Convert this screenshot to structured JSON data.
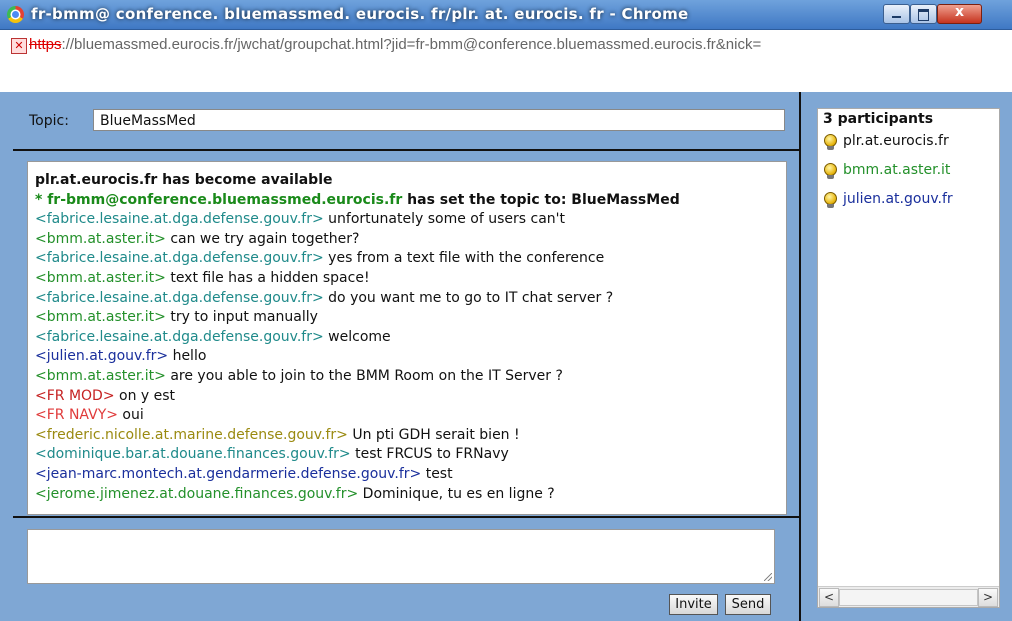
{
  "window": {
    "title": "fr-bmm@ conference. bluemassmed. eurocis. fr/plr. at. eurocis. fr -  Chrome",
    "close_label": "x"
  },
  "address": {
    "scheme": "https",
    "rest": "://bluemassmed.eurocis.fr/jwchat/groupchat.html?jid=fr-bmm@conference.bluemassmed.eurocis.fr&nick="
  },
  "topic": {
    "label": "Topic:",
    "value": "BlueMassMed"
  },
  "chat": {
    "messages": [
      {
        "nick": "",
        "text": "plr.at.eurocis.fr has become available",
        "style": "bold"
      },
      {
        "nick": "* fr-bmm@conference.bluemassmed.eurocis.fr",
        "text": " has set the topic to: BlueMassMed",
        "style": "topic"
      },
      {
        "nick": "<fabrice.lesaine.at.dga.defense.gouv.fr>",
        "text": " unfortunately some of users can't",
        "color": "#1f8a8a"
      },
      {
        "nick": "<bmm.at.aster.it>",
        "text": " can we try again together?",
        "color": "#23902a"
      },
      {
        "nick": "<fabrice.lesaine.at.dga.defense.gouv.fr>",
        "text": " yes from a text file with the conference",
        "color": "#1f8a8a"
      },
      {
        "nick": "<bmm.at.aster.it>",
        "text": " text file has a hidden space!",
        "color": "#23902a"
      },
      {
        "nick": "<fabrice.lesaine.at.dga.defense.gouv.fr>",
        "text": " do you want me to go to IT chat server ?",
        "color": "#1f8a8a"
      },
      {
        "nick": "<bmm.at.aster.it>",
        "text": " try to input manually",
        "color": "#23902a"
      },
      {
        "nick": "<fabrice.lesaine.at.dga.defense.gouv.fr>",
        "text": " welcome",
        "color": "#1f8a8a"
      },
      {
        "nick": "<julien.at.gouv.fr>",
        "text": " hello",
        "color": "#1a2f9c"
      },
      {
        "nick": "<bmm.at.aster.it>",
        "text": " are you able to join to the BMM Room on the IT Server ?",
        "color": "#23902a"
      },
      {
        "nick": "<FR MOD>",
        "text": " on y est",
        "color": "#c62222"
      },
      {
        "nick": "<FR NAVY>",
        "text": " oui",
        "color": "#e03a3a"
      },
      {
        "nick": "<frederic.nicolle.at.marine.defense.gouv.fr>",
        "text": " Un pti GDH serait bien !",
        "color": "#9a8a10"
      },
      {
        "nick": "<dominique.bar.at.douane.finances.gouv.fr>",
        "text": " test FRCUS to FRNavy",
        "color": "#1f8a8a"
      },
      {
        "nick": "<jean-marc.montech.at.gendarmerie.defense.gouv.fr>",
        "text": " test",
        "color": "#1a2f9c"
      },
      {
        "nick": "<jerome.jimenez.at.douane.finances.gouv.fr>",
        "text": " Dominique, tu es en ligne ?",
        "color": "#23902a"
      }
    ]
  },
  "buttons": {
    "invite": "Invite",
    "send": "Send"
  },
  "participants": {
    "count_label": "3 participants",
    "items": [
      {
        "name": "plr.at.eurocis.fr",
        "color": "#111111"
      },
      {
        "name": "bmm.at.aster.it",
        "color": "#23902a"
      },
      {
        "name": "julien.at.gouv.fr",
        "color": "#1a2f9c"
      }
    ]
  },
  "scrollbar": {
    "left_arrow": "<",
    "right_arrow": ">"
  }
}
